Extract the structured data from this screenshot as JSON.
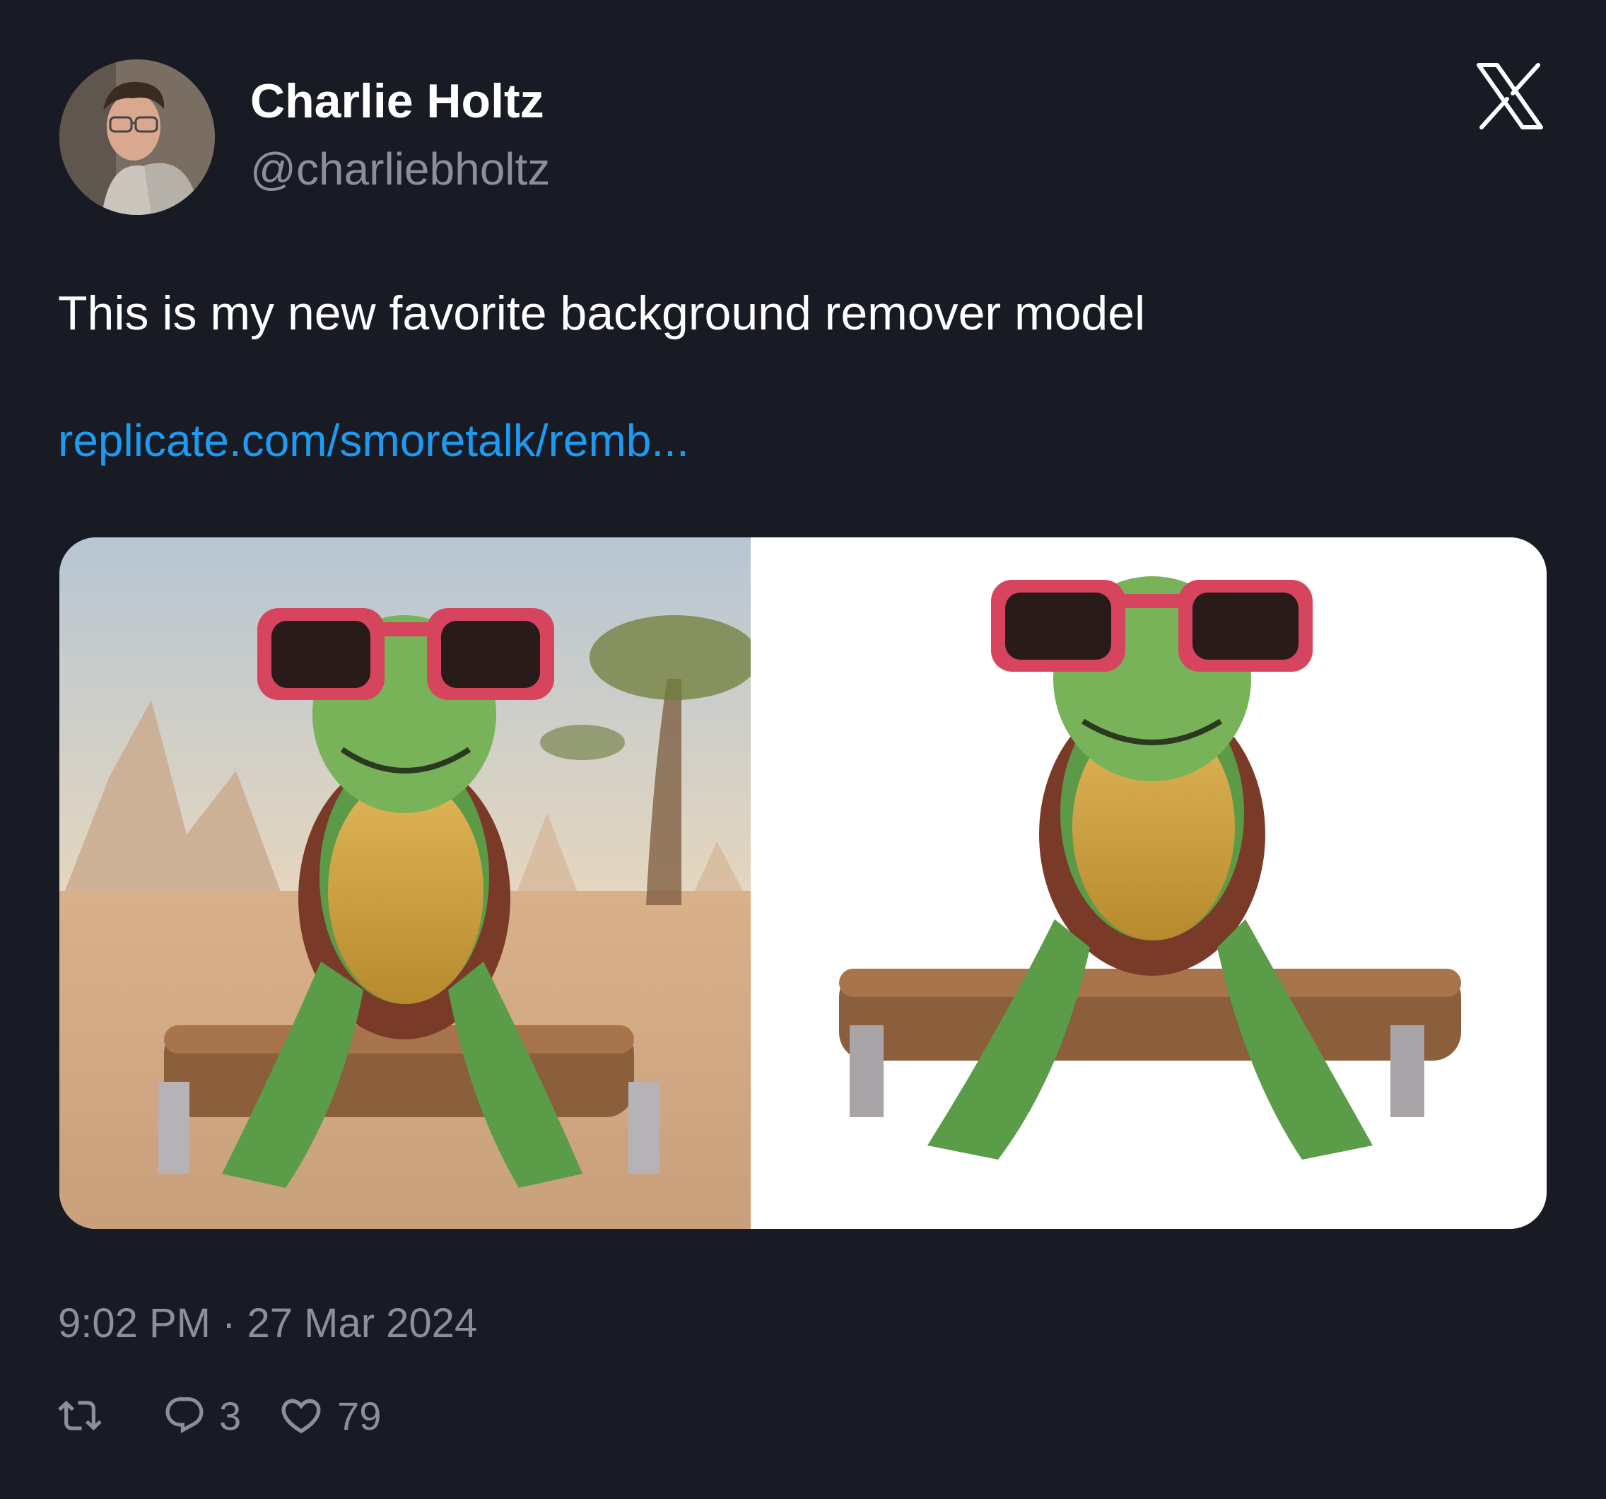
{
  "author": {
    "name": "Charlie Holtz",
    "handle": "@charliebholtz"
  },
  "brand_icon": "x-logo-icon",
  "tweet": {
    "text": "This is my new favorite background remover model",
    "link": "replicate.com/smoretalk/remb...",
    "timestamp": "9:02 PM · 27 Mar 2024"
  },
  "actions": {
    "retweet_icon": "retweet-icon",
    "reply_icon": "reply-icon",
    "reply_count": "3",
    "like_icon": "heart-icon",
    "like_count": "79"
  },
  "colors": {
    "background": "#181a24",
    "link": "#1d9bf0",
    "secondary_text": "#8b8f99"
  }
}
